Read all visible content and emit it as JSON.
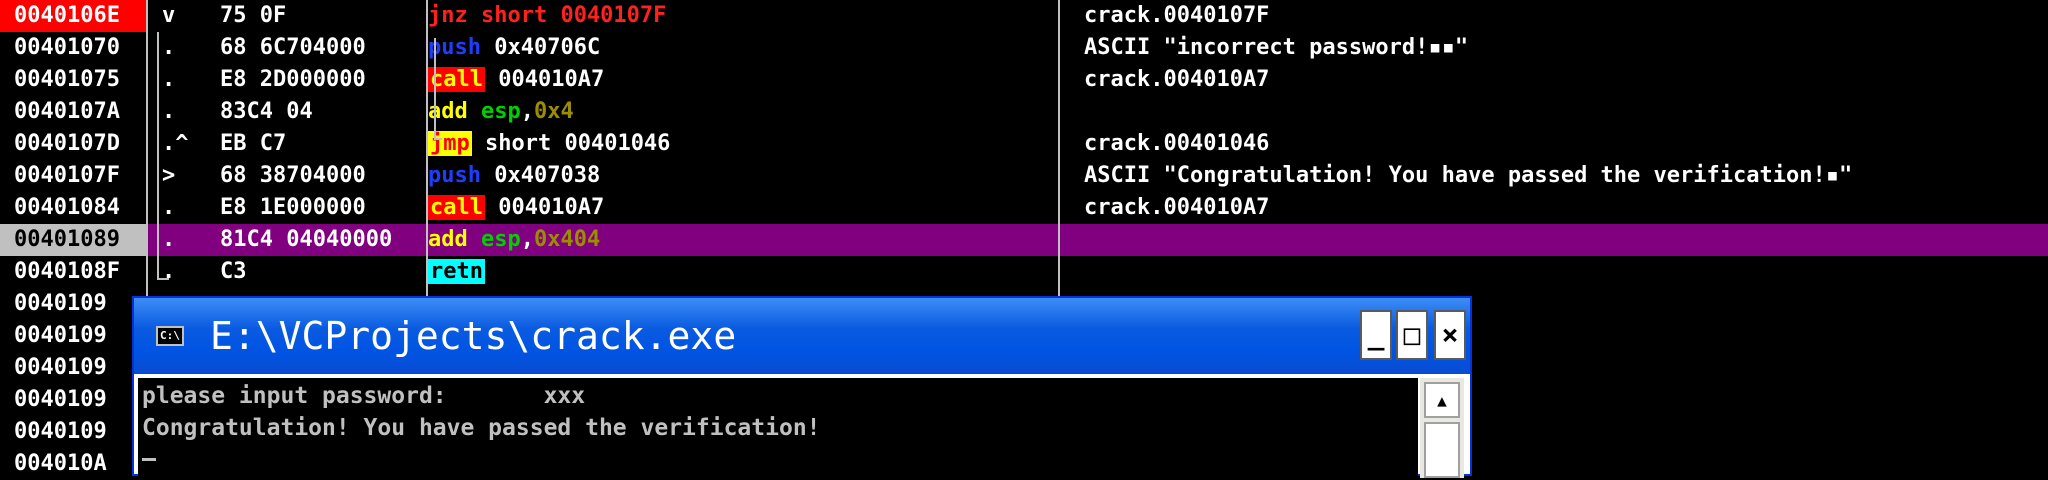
{
  "disasm": {
    "rows": [
      {
        "addr": "0040106E",
        "mark": "v",
        "hex": "75 0F",
        "asm": [
          {
            "t": "jnz short 0040107F",
            "c": "kw-red"
          }
        ],
        "comment": "crack.0040107F",
        "style": "hl"
      },
      {
        "addr": "00401070",
        "mark": ".",
        "hex": "68 6C704000",
        "asm": [
          {
            "t": "push",
            "c": "kw-blue"
          },
          {
            "t": " 0x40706C",
            "c": "kw-white"
          }
        ],
        "comment": "ASCII \"incorrect password!▪▪\"",
        "style": ""
      },
      {
        "addr": "00401075",
        "mark": ".",
        "hex": "E8 2D000000",
        "asm": [
          {
            "t": "call",
            "c": "bg-red"
          },
          {
            "t": " 004010A7",
            "c": "kw-white"
          }
        ],
        "comment": "crack.004010A7",
        "style": ""
      },
      {
        "addr": "0040107A",
        "mark": ".",
        "hex": "83C4 04",
        "asm": [
          {
            "t": "add",
            "c": "kw-yellow"
          },
          {
            "t": " esp",
            "c": "kw-green"
          },
          {
            "t": ",",
            "c": "kw-white"
          },
          {
            "t": "0x4",
            "c": "kw-olive"
          }
        ],
        "comment": "",
        "style": ""
      },
      {
        "addr": "0040107D",
        "mark": ".^",
        "hex": "EB C7",
        "asm": [
          {
            "t": "jmp",
            "c": "bg-yellow"
          },
          {
            "t": " short 00401046",
            "c": "kw-white"
          }
        ],
        "comment": "crack.00401046",
        "style": ""
      },
      {
        "addr": "0040107F",
        "mark": ">",
        "hex": "68 38704000",
        "asm": [
          {
            "t": "push",
            "c": "kw-blue"
          },
          {
            "t": " 0x407038",
            "c": "kw-white"
          }
        ],
        "comment": "ASCII \"Congratulation! You have passed the verification!▪\"",
        "style": ""
      },
      {
        "addr": "00401084",
        "mark": ".",
        "hex": "E8 1E000000",
        "asm": [
          {
            "t": "call",
            "c": "bg-red"
          },
          {
            "t": " 004010A7",
            "c": "kw-white"
          }
        ],
        "comment": "crack.004010A7",
        "style": ""
      },
      {
        "addr": "00401089",
        "mark": ".",
        "hex": "81C4 04040000",
        "asm": [
          {
            "t": "add",
            "c": "kw-yellow"
          },
          {
            "t": " esp",
            "c": "kw-green"
          },
          {
            "t": ",",
            "c": "kw-white"
          },
          {
            "t": "0x404",
            "c": "kw-olive"
          }
        ],
        "comment": "",
        "style": "cur"
      },
      {
        "addr": "0040108F",
        "mark": ".",
        "hex": "C3",
        "asm": [
          {
            "t": "retn",
            "c": "bg-cyan"
          }
        ],
        "comment": "",
        "style": ""
      },
      {
        "addr": "0040109",
        "mark": "",
        "hex": "",
        "asm": [],
        "comment": "",
        "style": ""
      },
      {
        "addr": "0040109",
        "mark": "",
        "hex": "",
        "asm": [],
        "comment": "",
        "style": ""
      },
      {
        "addr": "0040109",
        "mark": "",
        "hex": "",
        "asm": [],
        "comment": "",
        "style": ""
      },
      {
        "addr": "0040109",
        "mark": "",
        "hex": "",
        "asm": [],
        "comment": "",
        "style": ""
      },
      {
        "addr": "0040109",
        "mark": "",
        "hex": "",
        "asm": [],
        "comment": "",
        "style": ""
      },
      {
        "addr": "004010A",
        "mark": "",
        "hex": "",
        "asm": [],
        "comment": "",
        "style": ""
      }
    ]
  },
  "console_window": {
    "title": "E:\\VCProjects\\crack.exe",
    "icon_text": "C:\\",
    "min_label": "_",
    "max_label": "□",
    "close_label": "×",
    "lines": [
      "please input password:       xxx",
      "Congratulation! You have passed the verification!"
    ],
    "scroll_up_label": "▲"
  },
  "colors": {
    "selected_row": "#800080",
    "title_bar": "#0054e3",
    "background": "#000000"
  }
}
